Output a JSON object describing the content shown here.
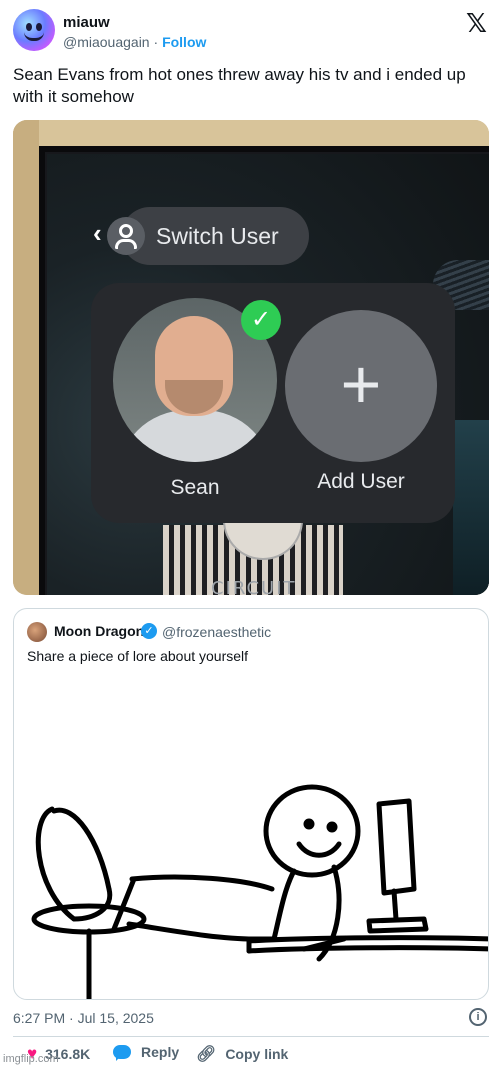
{
  "author": {
    "name": "miauw",
    "handle": "@miaouagain",
    "separator": "·",
    "follow_label": "Follow"
  },
  "platform_icon": "x-logo-icon",
  "tweet": {
    "text": "Sean Evans from hot ones threw away his tv and i ended up with it somehow"
  },
  "photo": {
    "switch_user_label": "Switch User",
    "back_glyph": "‹",
    "user_name": "Sean",
    "add_user_label": "Add User",
    "add_glyph": "+",
    "check_glyph": "✓",
    "background_text": "CIRCUIT"
  },
  "quoted_tweet": {
    "name": "Moon Dragon",
    "verified": true,
    "handle": "@frozenaesthetic",
    "text": "Share a piece of lore about yourself",
    "image_icon": "stick-figure-drawing"
  },
  "meta": {
    "timestamp": "6:27 PM · Jul 15, 2025",
    "info_glyph": "i"
  },
  "actions": {
    "like_count": "316.8K",
    "reply_label": "Reply",
    "copy_link_label": "Copy link"
  },
  "watermark": "imgflip.com",
  "colors": {
    "accent": "#1d9bf0",
    "like": "#f91880",
    "verified_check": "#2ecc54",
    "text_primary": "#0f1419",
    "text_secondary": "#536471"
  }
}
